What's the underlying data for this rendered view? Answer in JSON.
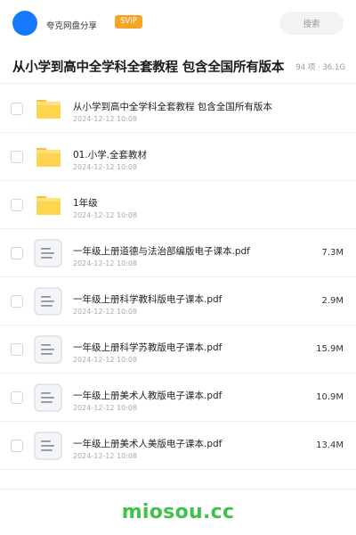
{
  "header": {
    "share_name": "夸克网盘分享",
    "badge": "SVIP",
    "search_placeholder": "搜索"
  },
  "folder": {
    "title": "从小学到高中全学科全套教程 包含全国所有版本",
    "meta": "94 项 · 36.1G"
  },
  "items": [
    {
      "type": "folder",
      "icon": "folder-icon",
      "name": "从小学到高中全学科全套教程 包含全国所有版本",
      "date": "2024-12-12 10:08",
      "size": ""
    },
    {
      "type": "folder",
      "icon": "folder-icon",
      "name": "01.小学.全套教材",
      "date": "2024-12-12 10:08",
      "size": ""
    },
    {
      "type": "folder",
      "icon": "folder-icon",
      "name": "1年级",
      "date": "2024-12-12 10:08",
      "size": ""
    },
    {
      "type": "file",
      "icon": "document-icon",
      "name": "一年级上册道德与法治部编版电子课本.pdf",
      "date": "2024-12-12 10:08",
      "size": "7.3M"
    },
    {
      "type": "file",
      "icon": "document-icon",
      "name": "一年级上册科学教科版电子课本.pdf",
      "date": "2024-12-12 10:08",
      "size": "2.9M"
    },
    {
      "type": "file",
      "icon": "document-icon",
      "name": "一年级上册科学苏教版电子课本.pdf",
      "date": "2024-12-12 10:08",
      "size": "15.9M"
    },
    {
      "type": "file",
      "icon": "document-icon",
      "name": "一年级上册美术人教版电子课本.pdf",
      "date": "2024-12-12 10:08",
      "size": "10.9M"
    },
    {
      "type": "file",
      "icon": "document-icon",
      "name": "一年级上册美术人美版电子课本.pdf",
      "date": "2024-12-12 10:08",
      "size": "13.4M"
    }
  ],
  "footer": {
    "brand": "miosou.cc"
  },
  "colors": {
    "avatar": "#1677ff",
    "badge": "#f7a325",
    "folder": "#fbc02d",
    "brand": "#3ec24a"
  }
}
